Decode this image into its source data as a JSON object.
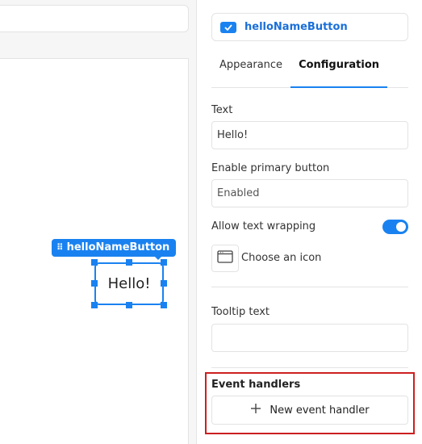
{
  "canvas": {
    "selected_component_tag": "helloNameButton",
    "button_text": "Hello!"
  },
  "inspector": {
    "component_name": "helloNameButton",
    "component_icon": "button-icon",
    "tabs": [
      {
        "label": "Appearance",
        "active": false
      },
      {
        "label": "Configuration",
        "active": true
      }
    ],
    "fields": {
      "text_label": "Text",
      "text_value": "Hello!",
      "primary_label": "Enable primary button",
      "primary_placeholder": "Enabled",
      "wrapping_label": "Allow text wrapping",
      "wrapping_enabled": true,
      "icon_label": "Choose an icon",
      "tooltip_label": "Tooltip text",
      "tooltip_value": ""
    },
    "events": {
      "title": "Event handlers",
      "new_handler_label": "New event handler"
    },
    "colors": {
      "accent": "#1a82f0",
      "highlight_border": "#cc1f1f"
    }
  }
}
